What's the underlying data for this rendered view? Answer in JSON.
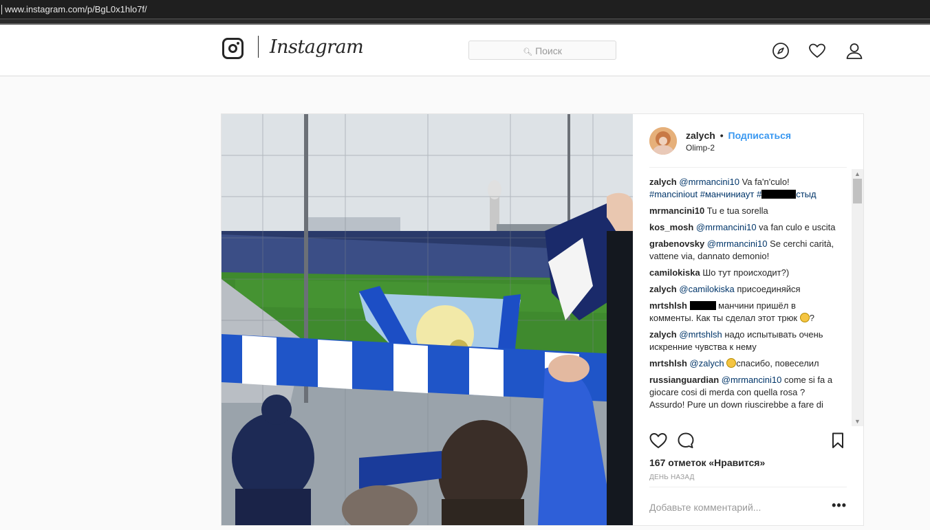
{
  "browser": {
    "url": "www.instagram.com/p/BgL0x1hlo7f/"
  },
  "header": {
    "wordmark": "Instagram",
    "search_placeholder": "Поиск"
  },
  "post": {
    "author": "zalych",
    "separator": "•",
    "follow_label": "Подписаться",
    "location": "Olimp-2",
    "comments": [
      {
        "user": "zalych",
        "parts": [
          {
            "type": "mention",
            "text": "@mrmancini10"
          },
          {
            "type": "text",
            "text": " Va fa'n'culo!"
          },
          {
            "type": "br"
          },
          {
            "type": "mention",
            "text": "#manciniout"
          },
          {
            "type": "text",
            "text": " "
          },
          {
            "type": "mention",
            "text": "#манчиниаут"
          },
          {
            "type": "text",
            "text": " "
          },
          {
            "type": "mention",
            "text": "#"
          },
          {
            "type": "redacted",
            "width": 50
          },
          {
            "type": "mention",
            "text": "стыд"
          }
        ]
      },
      {
        "user": "mrmancini10",
        "parts": [
          {
            "type": "text",
            "text": "Tu e tua sorella"
          }
        ]
      },
      {
        "user": "kos_mosh",
        "parts": [
          {
            "type": "mention",
            "text": "@mrmancini10"
          },
          {
            "type": "text",
            "text": " va fan culo e uscita"
          }
        ]
      },
      {
        "user": "grabenovsky",
        "parts": [
          {
            "type": "mention",
            "text": "@mrmancini10"
          },
          {
            "type": "text",
            "text": " Se cerchi carità, vattene via, dannato demonio!"
          }
        ]
      },
      {
        "user": "camilokiska",
        "parts": [
          {
            "type": "text",
            "text": "Шо тут происходит?)"
          }
        ]
      },
      {
        "user": "zalych",
        "parts": [
          {
            "type": "mention",
            "text": "@camilokiska"
          },
          {
            "type": "text",
            "text": " присоединяйся"
          }
        ]
      },
      {
        "user": "mrtshlsh",
        "parts": [
          {
            "type": "redacted",
            "width": 38
          },
          {
            "type": "text",
            "text": " манчини пришёл в комменты. Как ты сделал этот трюк "
          },
          {
            "type": "emoji"
          },
          {
            "type": "text",
            "text": "?"
          }
        ]
      },
      {
        "user": "zalych",
        "parts": [
          {
            "type": "mention",
            "text": "@mrtshlsh"
          },
          {
            "type": "text",
            "text": " надо испытывать очень искренние чувства к нему"
          }
        ]
      },
      {
        "user": "mrtshlsh",
        "parts": [
          {
            "type": "mention",
            "text": "@zalych"
          },
          {
            "type": "text",
            "text": " "
          },
          {
            "type": "emoji"
          },
          {
            "type": "text",
            "text": "спасибо, повеселил"
          }
        ]
      },
      {
        "user": "russianguardian",
        "parts": [
          {
            "type": "mention",
            "text": "@mrmancini10"
          },
          {
            "type": "text",
            "text": " come si fa a giocare cosi di merda con quella rosa ? Assurdo! Pure un down riuscirebbe a fare di"
          }
        ]
      }
    ],
    "likes_label": "167 отметок «Нравится»",
    "timestamp": "ДЕНЬ НАЗАД",
    "add_comment_placeholder": "Добавьте комментарий...",
    "more_label": "•••"
  }
}
